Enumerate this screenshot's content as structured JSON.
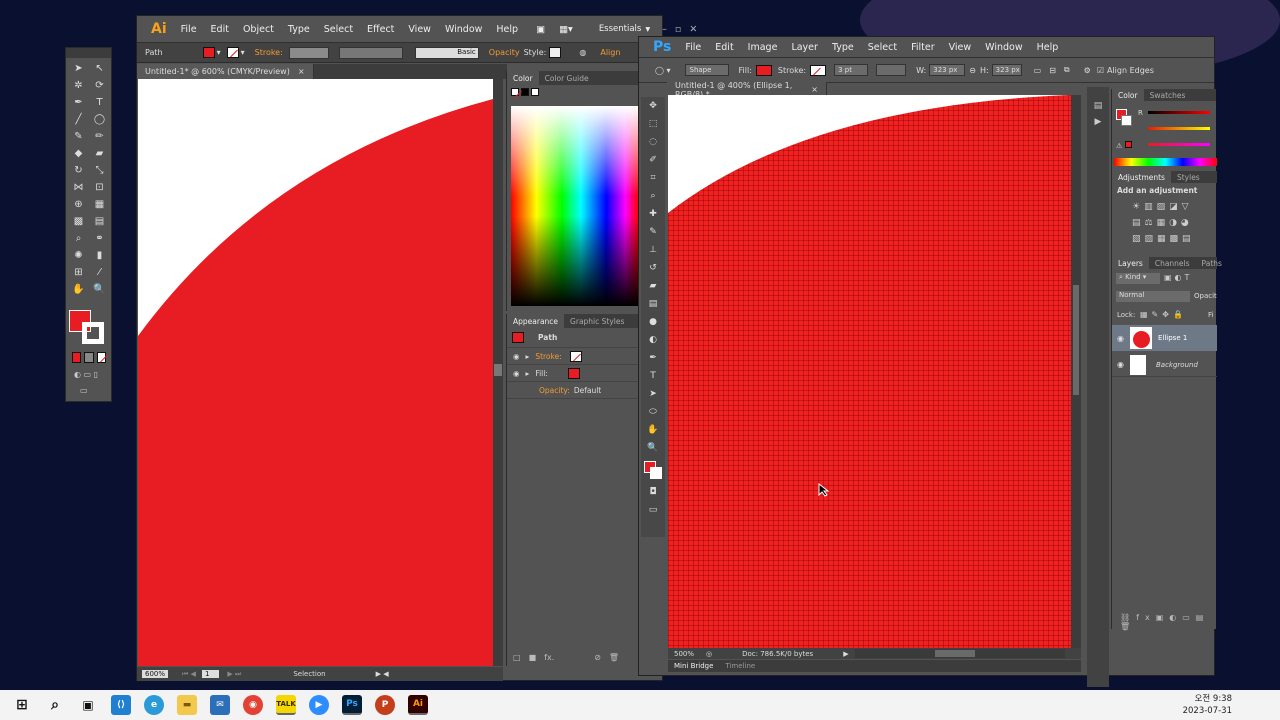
{
  "illustrator": {
    "logo": "Ai",
    "menu": [
      "File",
      "Edit",
      "Object",
      "Type",
      "Select",
      "Effect",
      "View",
      "Window",
      "Help"
    ],
    "workspace": "Essentials",
    "control": {
      "selection": "Path",
      "stroke_label": "Stroke:",
      "brush": "Basic",
      "opacity_label": "Opacity",
      "style_label": "Style:",
      "align": "Align"
    },
    "doc_tab": "Untitled-1* @ 600% (CMYK/Preview)",
    "color_panel": {
      "tabs": [
        "Color",
        "Color Guide"
      ]
    },
    "appearance": {
      "tabs": [
        "Appearance",
        "Graphic Styles"
      ],
      "title": "Path",
      "stroke": "Stroke:",
      "fill": "Fill:",
      "opacity": "Opacity:",
      "opacity_value": "Default"
    },
    "status": {
      "zoom": "600%",
      "page": "1",
      "mode": "Selection"
    }
  },
  "photoshop": {
    "logo": "Ps",
    "menu": [
      "File",
      "Edit",
      "Image",
      "Layer",
      "Type",
      "Select",
      "Filter",
      "View",
      "Window",
      "Help"
    ],
    "options": {
      "mode": "Shape",
      "fill": "Fill:",
      "stroke": "Stroke:",
      "stroke_size": "3 pt",
      "w_label": "W:",
      "w_value": "323 px",
      "h_label": "H:",
      "h_value": "323 px",
      "align_edges": "Align Edges"
    },
    "doc_tab": "Untitled-1 @ 400% (Ellipse 1, RGB/8) *",
    "color_panel": {
      "tabs": [
        "Color",
        "Swatches"
      ],
      "r": "R"
    },
    "adjustments": {
      "tabs": [
        "Adjustments",
        "Styles"
      ],
      "title": "Add an adjustment"
    },
    "layers": {
      "tabs": [
        "Layers",
        "Channels",
        "Paths"
      ],
      "kind": "Kind",
      "blend": "Normal",
      "opacity": "Opacit",
      "lock": "Lock:",
      "fill": "Fi",
      "items": [
        "Ellipse 1",
        "Background"
      ]
    },
    "status": {
      "zoom": "500%",
      "doc": "Doc: 786.5K/0 bytes"
    },
    "bottom_tabs": [
      "Mini Bridge",
      "Timeline"
    ]
  },
  "taskbar": {
    "time": "오전 9:38",
    "date": "2023-07-31"
  },
  "colors": {
    "fill": "#e81c23",
    "ps_fill": "#f12021"
  }
}
